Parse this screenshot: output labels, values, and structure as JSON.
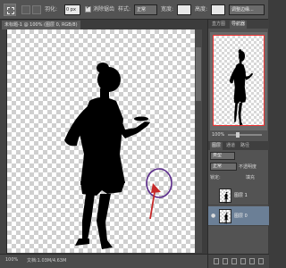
{
  "options_bar": {
    "tool_name": "rectangular-marquee-tool",
    "feather_label": "羽化:",
    "feather_value": "0 px",
    "antialias_label": "消除锯齿",
    "style_label": "样式:",
    "style_value": "正常",
    "width_label": "宽度:",
    "height_label": "高度:",
    "refine_edge_label": "调整边缘..."
  },
  "document": {
    "tab_title": "未标题-1 @ 100% (图层 0, RGB/8)",
    "zoom_status": "100%",
    "doc_info": "文档:1.03M/4.63M"
  },
  "right_panel": {
    "tabs": [
      "直方图",
      "导航器"
    ],
    "navigator_zoom": "100%",
    "layers_tabs": [
      "图层",
      "通道",
      "路径"
    ],
    "kind_label": "类型",
    "blend_mode": "正常",
    "opacity_label": "不透明度",
    "lock_label": "锁定:",
    "fill_label": "填充",
    "layers": [
      {
        "name": "图层 1",
        "visible": false
      },
      {
        "name": "图层 0",
        "visible": true
      }
    ]
  },
  "colors": {
    "panel_bg": "#535353",
    "annotation_circle": "#5a2a8a",
    "annotation_arrow": "#c62828"
  }
}
